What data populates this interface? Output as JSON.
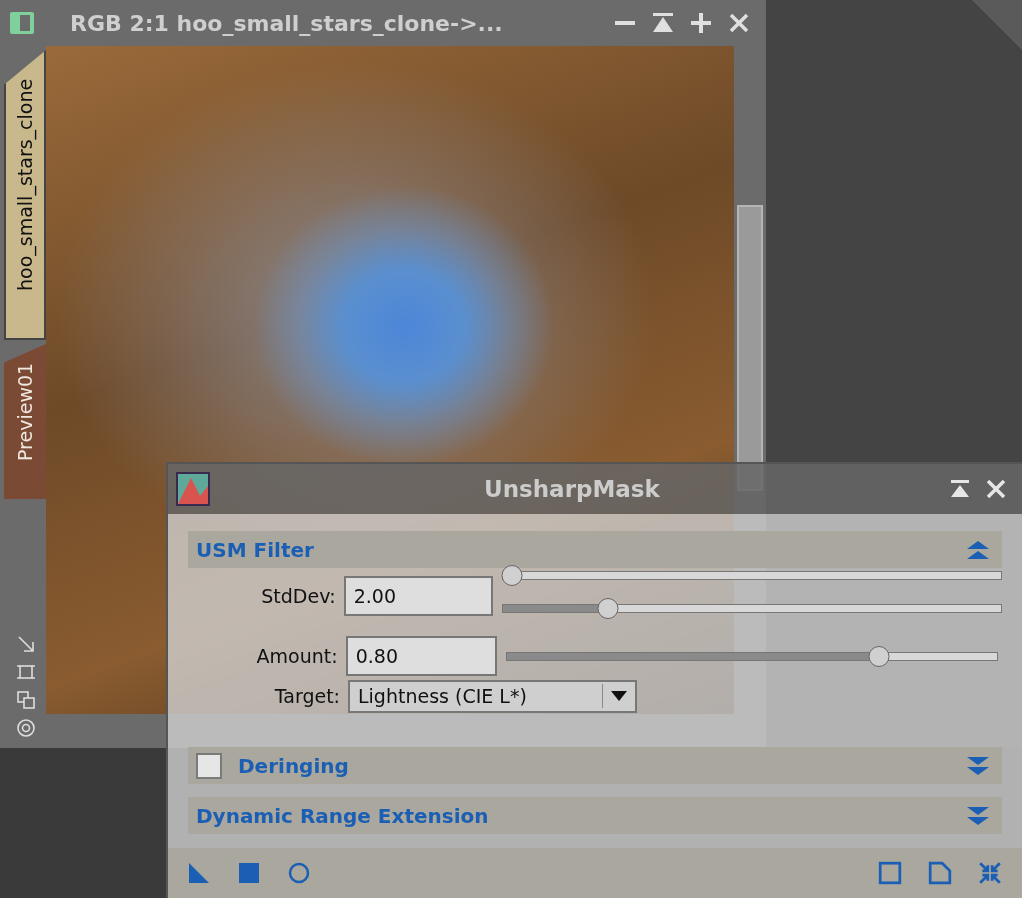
{
  "image_window": {
    "title": "RGB 2:1 hoo_small_stars_clone->...",
    "tabs": [
      {
        "label": "hoo_small_stars_clone",
        "selected": true
      },
      {
        "label": "Preview01",
        "selected": false
      }
    ]
  },
  "dialog": {
    "title": "UnsharpMask",
    "sections": [
      {
        "title": "USM Filter",
        "expanded": true
      },
      {
        "title": "Deringing",
        "expanded": false,
        "kind": "checkbox",
        "checked": false
      },
      {
        "title": "Dynamic Range Extension",
        "expanded": false
      }
    ],
    "stddev": {
      "label": "StdDev:",
      "value": "2.00",
      "sliders": [
        {
          "level": 0
        },
        {
          "level": 0.2
        }
      ]
    },
    "amount": {
      "label": "Amount:",
      "value": "0.80",
      "level": 0.77
    },
    "target": {
      "label": "Target:",
      "value": "Lightness (CIE L*)"
    }
  }
}
